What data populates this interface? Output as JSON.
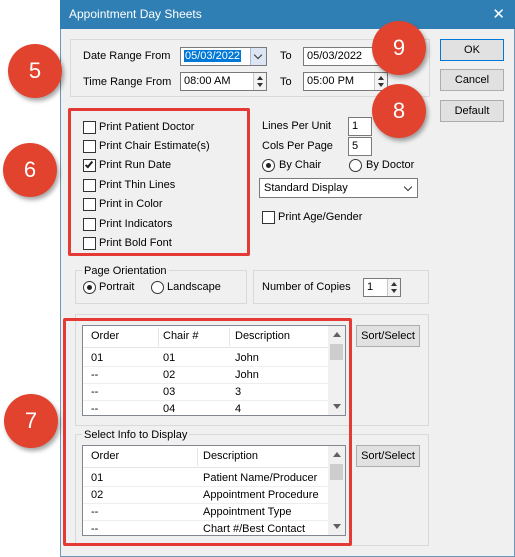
{
  "window": {
    "title": "Appointment Day Sheets",
    "close_glyph": "✕"
  },
  "date_range": {
    "from_label": "Date Range From",
    "from_value": "05/03/2022",
    "to_label": "To",
    "to_value": "05/03/2022"
  },
  "time_range": {
    "from_label": "Time Range From",
    "from_value": "08:00 AM",
    "to_label": "To",
    "to_value": "05:00 PM"
  },
  "buttons": {
    "ok": "OK",
    "cancel": "Cancel",
    "default": "Default",
    "sort_select_1": "Sort/Select",
    "sort_select_2": "Sort/Select"
  },
  "options": [
    {
      "label": "Print Patient Doctor",
      "checked": false
    },
    {
      "label": "Print Chair Estimate(s)",
      "checked": false
    },
    {
      "label": "Print Run Date",
      "checked": true
    },
    {
      "label": "Print Thin Lines",
      "checked": false
    },
    {
      "label": "Print in Color",
      "checked": false
    },
    {
      "label": "Print Indicators",
      "checked": false
    },
    {
      "label": "Print Bold Font",
      "checked": false
    }
  ],
  "layout_opts": {
    "lines_per_unit_label": "Lines Per Unit",
    "lines_per_unit": "1",
    "cols_per_page_label": "Cols Per Page",
    "cols_per_page": "5",
    "by_chair_label": "By Chair",
    "by_doctor_label": "By Doctor",
    "selected": "By Chair",
    "display_select": "Standard Display",
    "age_gender_label": "Print Age/Gender",
    "age_gender_checked": false
  },
  "orientation": {
    "label": "Page Orientation",
    "portrait": "Portrait",
    "landscape": "Landscape",
    "selected": "Portrait"
  },
  "copies": {
    "label": "Number of Copies",
    "value": "1"
  },
  "chair_list": {
    "headers": [
      "Order",
      "Chair #",
      "Description"
    ],
    "rows": [
      [
        "01",
        "01",
        "John"
      ],
      [
        "--",
        "02",
        "John"
      ],
      [
        "--",
        "03",
        "3"
      ],
      [
        "--",
        "04",
        "4"
      ]
    ]
  },
  "info_list": {
    "title": "Select Info to Display",
    "headers": [
      "Order",
      "Description"
    ],
    "rows": [
      [
        "01",
        "Patient Name/Producer"
      ],
      [
        "02",
        "Appointment Procedure"
      ],
      [
        "--",
        "Appointment Type"
      ],
      [
        "--",
        "Chart #/Best Contact"
      ]
    ]
  },
  "callouts": [
    "5",
    "6",
    "7",
    "8",
    "9"
  ],
  "colors": {
    "titlebar": "#2f7fb4",
    "callout": "#e2432f",
    "highlight_box": "#e53935",
    "selection": "#0078d7"
  }
}
